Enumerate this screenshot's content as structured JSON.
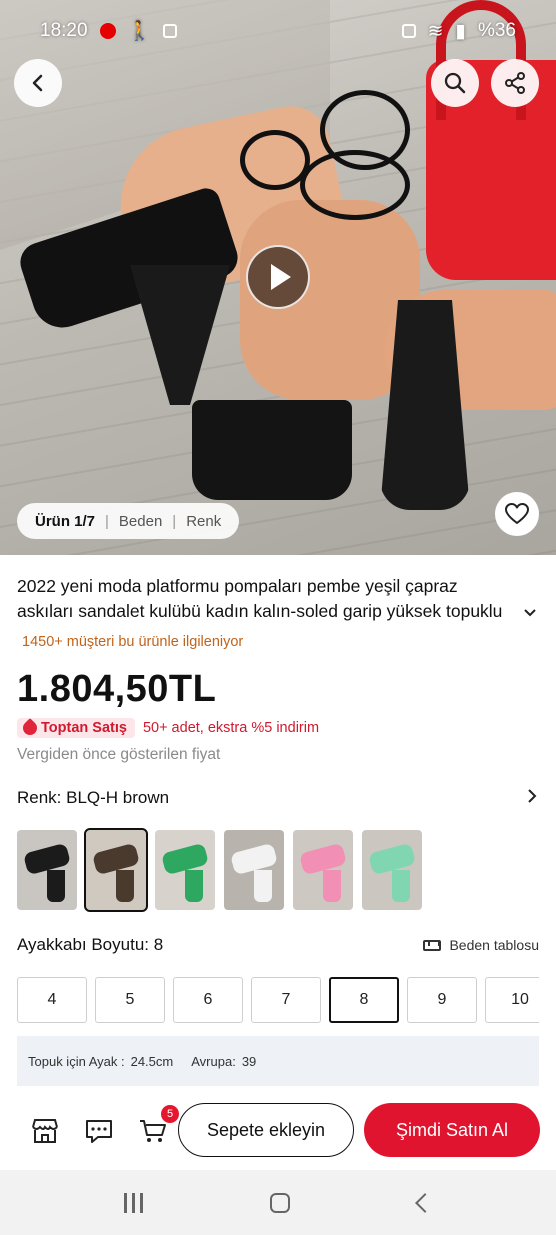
{
  "status_bar": {
    "time": "18:20",
    "battery": "%36"
  },
  "gallery": {
    "indicator_active": "Ürün 1/7",
    "indicator_sep1": "|",
    "indicator_item2": "Beden",
    "indicator_sep2": "|",
    "indicator_item3": "Renk"
  },
  "product": {
    "title_line1": "2022 yeni moda platformu pompaları pembe yeşil çapraz",
    "title_line2": "askıları sandalet kulübü kadın kalın-soled garip yüksek topuklu",
    "interest": "1450+ müşteri bu ürünle ilgileniyor",
    "price": "1.804,50TL",
    "wholesale_badge": "Toptan Satış",
    "wholesale_offer": "50+ adet, ekstra %5 indirim",
    "price_note": "Vergiden önce gösterilen fiyat"
  },
  "color": {
    "label": "Renk: BLQ-H brown",
    "swatches": [
      "#1b1b1b",
      "#4a3a2e",
      "#2ea860",
      "#f2f2f2",
      "#f28fb4",
      "#7fd6b0"
    ],
    "selected_index": 1
  },
  "size": {
    "label": "Ayakkabı Boyutu: 8",
    "chart_link": "Beden tablosu",
    "options": [
      "4",
      "5",
      "6",
      "7",
      "8",
      "9",
      "10"
    ],
    "selected": "8"
  },
  "measure": {
    "foot_label": "Topuk için Ayak :",
    "foot_value": "24.5cm",
    "eu_label": "Avrupa:",
    "eu_value": "39"
  },
  "actions": {
    "cart_count": "5",
    "add_to_cart": "Sepete ekleyin",
    "buy_now": "Şimdi Satın Al"
  },
  "colors": {
    "accent": "#e0142e",
    "interest": "#c0631b",
    "measure_bg": "#eef2f7"
  }
}
